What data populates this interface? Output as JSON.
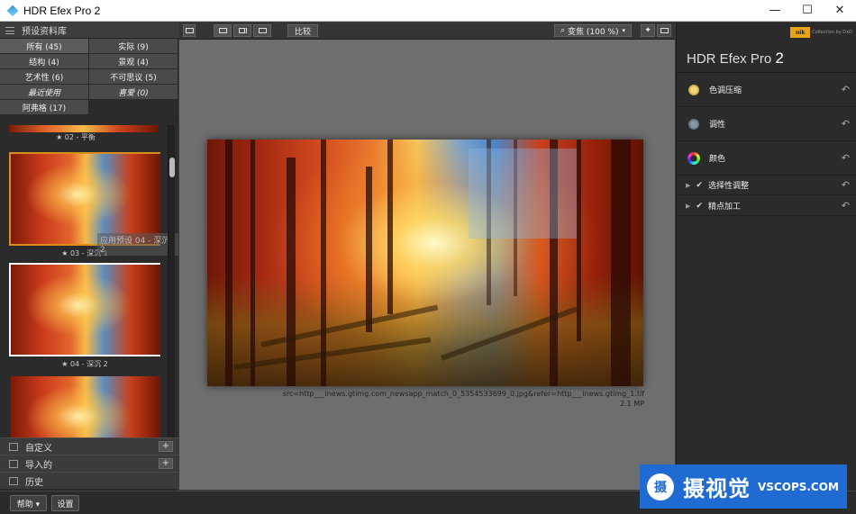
{
  "window": {
    "title": "HDR Efex Pro 2",
    "controls": {
      "minimize": "—",
      "maximize": "☐",
      "close": "✕"
    }
  },
  "left_panel": {
    "library_header": "预设资料库",
    "filters": [
      {
        "label": "所有 (45)",
        "active": true
      },
      {
        "label": "实际 (9)"
      },
      {
        "label": "结构 (4)"
      },
      {
        "label": "景观 (4)"
      },
      {
        "label": "艺术性 (6)"
      },
      {
        "label": "不可思议 (5)"
      },
      {
        "label": "最近使用"
      },
      {
        "label": "喜爱 (0)"
      },
      {
        "label": "阿弗格 (17)"
      }
    ],
    "thumbnails": [
      {
        "caption": "★ 02 - 平衡"
      },
      {
        "caption": "★ 03 - 深沉 1"
      },
      {
        "caption": "★ 04 - 深沉 2"
      }
    ],
    "tooltip": "应用预设 04 - 深沉 2",
    "sections": [
      {
        "label": "自定义",
        "plus": "+"
      },
      {
        "label": "导入的",
        "plus": "+"
      },
      {
        "label": "历史"
      }
    ]
  },
  "bottom_bar": {
    "help_button": "帮助 ▾",
    "settings_button": "设置"
  },
  "toolbar": {
    "compare_button": "比较",
    "zoom_label": "变焦 (100 %)"
  },
  "preview": {
    "filename": "src=http___inews.gtimg.com_newsapp_match_0_5354533699_0.jpg&refer=http___inews.gtimg_1.tif",
    "filesize": "2.1 MP"
  },
  "right_panel": {
    "brand": {
      "badge": "nik",
      "text": "Collection by DxO"
    },
    "product_name": "HDR Efex Pro",
    "product_version": "2",
    "panels": [
      {
        "label": "色调压缩",
        "icon": "sun-icon"
      },
      {
        "label": "调性",
        "icon": "tone-icon"
      },
      {
        "label": "颜色",
        "icon": "color-wheel-icon"
      }
    ],
    "check_panels": [
      {
        "label": "选择性调整"
      },
      {
        "label": "精点加工"
      }
    ],
    "undo_glyph": "↶"
  },
  "watermark": {
    "logo_char": "摄",
    "cn_text": "摄视觉",
    "en_text": "VSCOPS.COM"
  }
}
